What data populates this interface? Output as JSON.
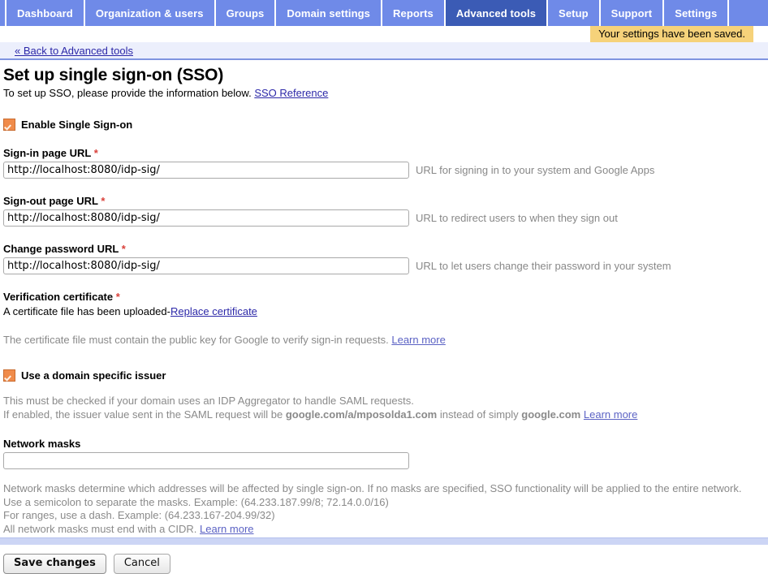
{
  "nav": {
    "tabs": [
      {
        "label": "Dashboard",
        "selected": false
      },
      {
        "label": "Organization & users",
        "selected": false
      },
      {
        "label": "Groups",
        "selected": false
      },
      {
        "label": "Domain settings",
        "selected": false
      },
      {
        "label": "Reports",
        "selected": false
      },
      {
        "label": "Advanced tools",
        "selected": true
      },
      {
        "label": "Setup",
        "selected": false
      },
      {
        "label": "Support",
        "selected": false
      },
      {
        "label": "Settings",
        "selected": false
      }
    ]
  },
  "notification": {
    "text": "Your settings have been saved.",
    "background": "#f6d27a"
  },
  "back_link": {
    "label": "« Back to Advanced tools"
  },
  "page": {
    "title": "Set up single sign-on (SSO)",
    "subtitle_text": "To set up SSO, please provide the information below.",
    "subtitle_link": "SSO Reference"
  },
  "enable_sso": {
    "label": "Enable Single Sign-on",
    "checked": true,
    "checkbox_color": "#f08b4a"
  },
  "fields": [
    {
      "label": "Sign-in page URL",
      "required": true,
      "required_marker": "*",
      "value": "http://localhost:8080/idp-sig/",
      "placeholder": "",
      "help": "URL for signing in to your system and Google Apps"
    },
    {
      "label": "Sign-out page URL",
      "required": true,
      "required_marker": "*",
      "value": "http://localhost:8080/idp-sig/",
      "placeholder": "",
      "help": "URL to redirect users to when they sign out"
    },
    {
      "label": "Change password URL",
      "required": true,
      "required_marker": "*",
      "value": "http://localhost:8080/idp-sig/",
      "placeholder": "",
      "help": "URL to let users change their password in your system"
    }
  ],
  "certificate": {
    "label": "Verification certificate",
    "required_marker": "*",
    "status_text": "A certificate file has been uploaded-",
    "replace_link": "Replace certificate",
    "note_text": "The certificate file must contain the public key for Google to verify sign-in requests.",
    "note_link": "Learn more"
  },
  "domain_issuer": {
    "label": "Use a domain specific issuer",
    "checked": true,
    "note_line1": "This must be checked if your domain uses an IDP Aggregator to handle SAML requests.",
    "note_line2_a": "If enabled, the issuer value sent in the SAML request will be",
    "note_line2_issuer": "google.com/a/mposolda1.com",
    "note_line2_b": "instead of simply",
    "note_line2_simple": "google.com",
    "note_link": "Learn more"
  },
  "network_masks": {
    "label": "Network masks",
    "value": "",
    "placeholder": "",
    "note_line1": "Network masks determine which addresses will be affected by single sign-on. If no masks are specified, SSO functionality will be applied to the entire network.",
    "note_line2": "Use a semicolon to separate the masks. Example: (64.233.187.99/8; 72.14.0.0/16)",
    "note_line3": "For ranges, use a dash. Example: (64.233.167-204.99/32)",
    "note_line4": "All network masks must end with a CIDR.",
    "note_link": "Learn more"
  },
  "actions": {
    "save_label": "Save changes",
    "cancel_label": "Cancel"
  }
}
